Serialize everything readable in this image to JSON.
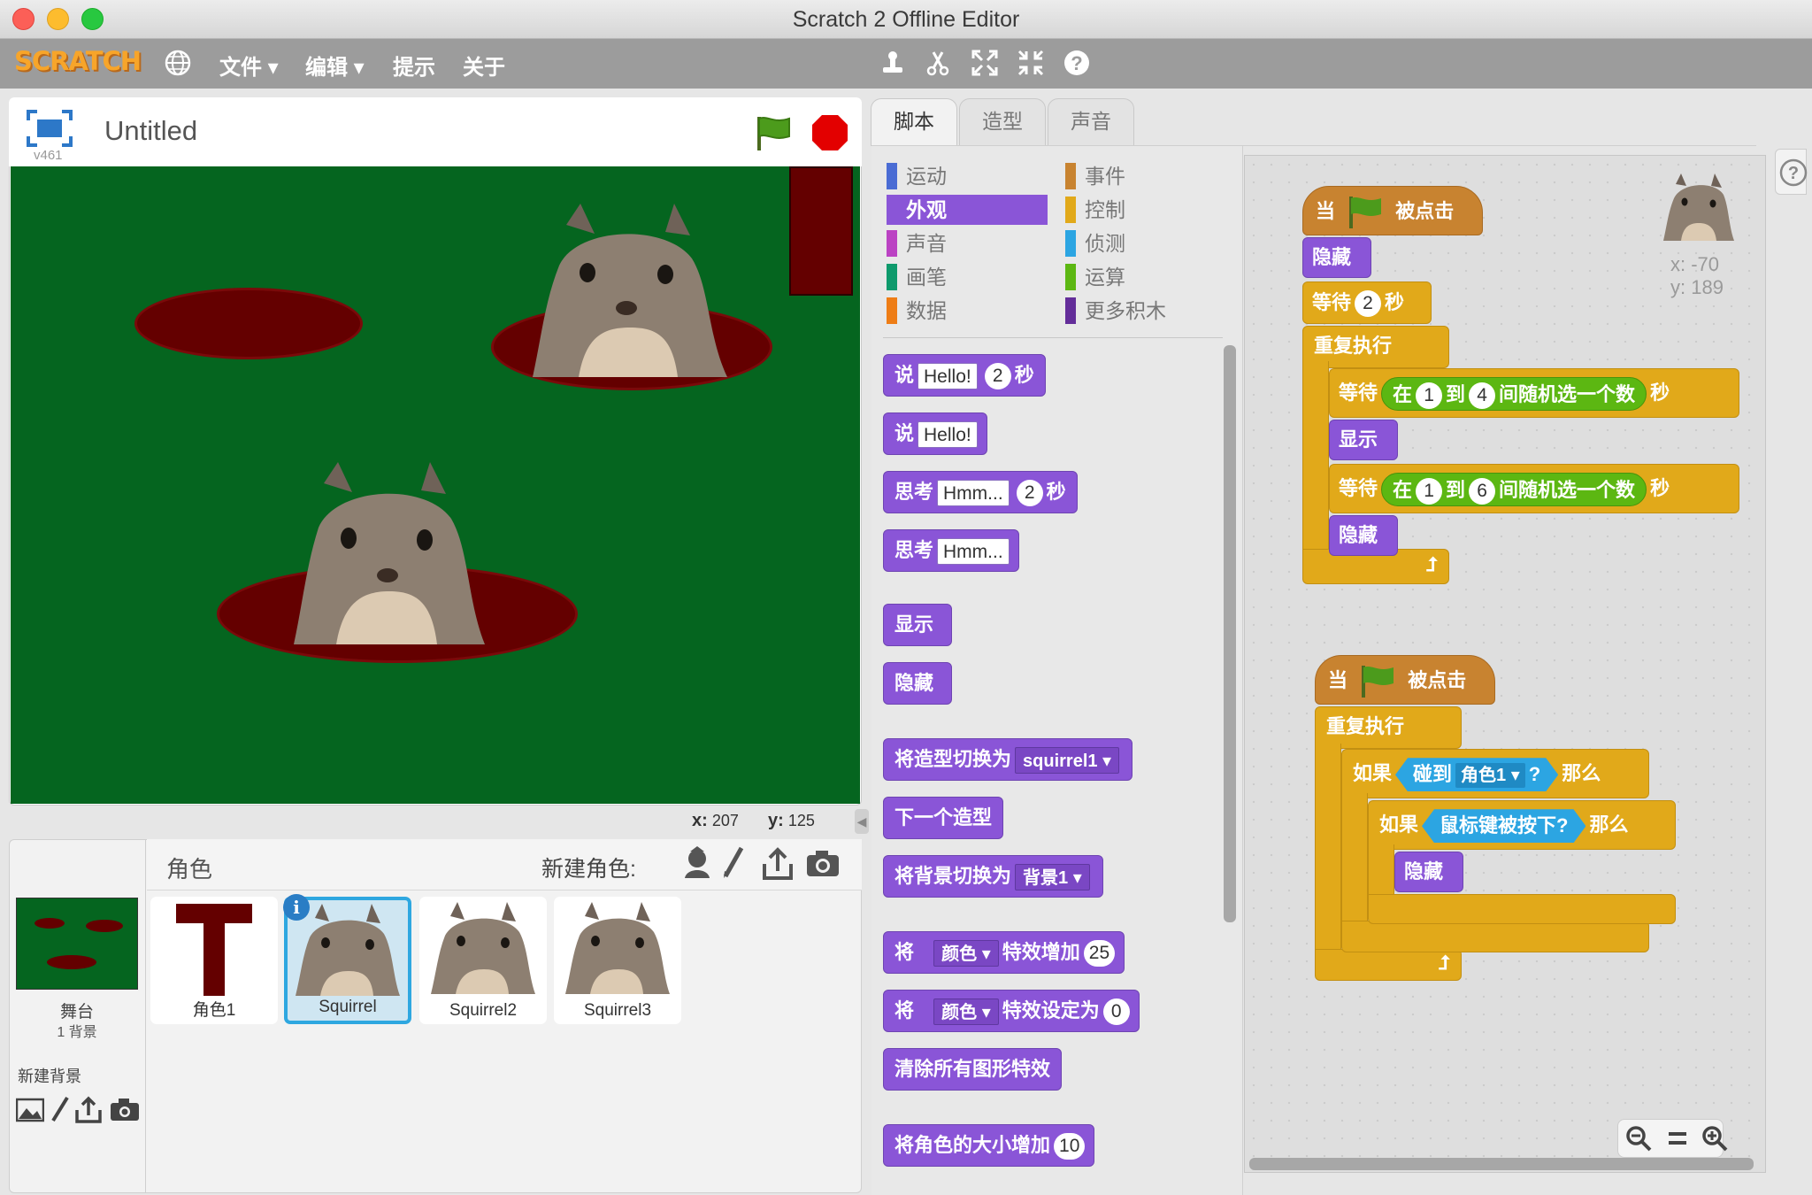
{
  "window": {
    "title": "Scratch 2 Offline Editor"
  },
  "menubar": {
    "logo": "SCRATCH",
    "items": [
      "文件 ▾",
      "编辑 ▾",
      "提示",
      "关于"
    ]
  },
  "stage_header": {
    "project_name": "Untitled",
    "version": "v461"
  },
  "stage_coords": {
    "x_label": "x:",
    "x_value": "207",
    "y_label": "y:",
    "y_value": "125"
  },
  "sprites_panel": {
    "title": "角色",
    "new_sprite_label": "新建角色:",
    "stage_name": "舞台",
    "stage_backdrops": "1 背景",
    "new_backdrop_label": "新建背景",
    "sprites": [
      {
        "name": "角色1"
      },
      {
        "name": "Squirrel",
        "selected": true
      },
      {
        "name": "Squirrel2"
      },
      {
        "name": "Squirrel3"
      }
    ]
  },
  "tabs": [
    "脚本",
    "造型",
    "声音"
  ],
  "categories": {
    "left": [
      {
        "label": "运动",
        "color": "#4a6cd4"
      },
      {
        "label": "外观",
        "color": "#8a55d7",
        "selected": true
      },
      {
        "label": "声音",
        "color": "#bb42c3"
      },
      {
        "label": "画笔",
        "color": "#0e9a6c"
      },
      {
        "label": "数据",
        "color": "#ee7d16"
      }
    ],
    "right": [
      {
        "label": "事件",
        "color": "#c88330"
      },
      {
        "label": "控制",
        "color": "#e1a91a"
      },
      {
        "label": "侦测",
        "color": "#2ca5e2"
      },
      {
        "label": "运算",
        "color": "#5cb712"
      },
      {
        "label": "更多积木",
        "color": "#632d99"
      }
    ]
  },
  "palette_blocks": {
    "say_secs": {
      "say": "说",
      "msg": "Hello!",
      "secs": "2",
      "unit": "秒"
    },
    "say": {
      "say": "说",
      "msg": "Hello!"
    },
    "think_secs": {
      "think": "思考",
      "msg": "Hmm...",
      "secs": "2",
      "unit": "秒"
    },
    "think": {
      "think": "思考",
      "msg": "Hmm..."
    },
    "show": "显示",
    "hide": "隐藏",
    "switch_costume": {
      "label": "将造型切换为",
      "value": "squirrel1"
    },
    "next_costume": "下一个造型",
    "switch_backdrop": {
      "label": "将背景切换为",
      "value": "背景1"
    },
    "change_effect": {
      "pre": "将",
      "effect": "颜色",
      "label": "特效增加",
      "value": "25"
    },
    "set_effect": {
      "pre": "将",
      "effect": "颜色",
      "label": "特效设定为",
      "value": "0"
    },
    "clear_effects": "清除所有图形特效",
    "change_size": {
      "label": "将角色的大小增加",
      "value": "10"
    }
  },
  "script1": {
    "hat_when": "当",
    "hat_clicked": "被点击",
    "hide": "隐藏",
    "wait": "等待",
    "wait_value": "2",
    "secs": "秒",
    "forever": "重复执行",
    "wait_rand1": {
      "wait": "等待",
      "in": "在",
      "from": "1",
      "to_word": "到",
      "to": "4",
      "pick": "间随机选一个数",
      "secs": "秒"
    },
    "show": "显示",
    "wait_rand2": {
      "wait": "等待",
      "in": "在",
      "from": "1",
      "to_word": "到",
      "to": "6",
      "pick": "间随机选一个数",
      "secs": "秒"
    },
    "hide2": "隐藏"
  },
  "script2": {
    "hat_when": "当",
    "hat_clicked": "被点击",
    "forever": "重复执行",
    "if1": "如果",
    "touching": "碰到",
    "touching_target": "角色1",
    "q": "?",
    "then1": "那么",
    "if2": "如果",
    "mouse_down": "鼠标键被按下?",
    "then2": "那么",
    "hide": "隐藏"
  },
  "sprite_info": {
    "x": "x: -70",
    "y": "y: 189"
  },
  "zoom": {
    "out": "−",
    "reset": "=",
    "in": "+"
  }
}
